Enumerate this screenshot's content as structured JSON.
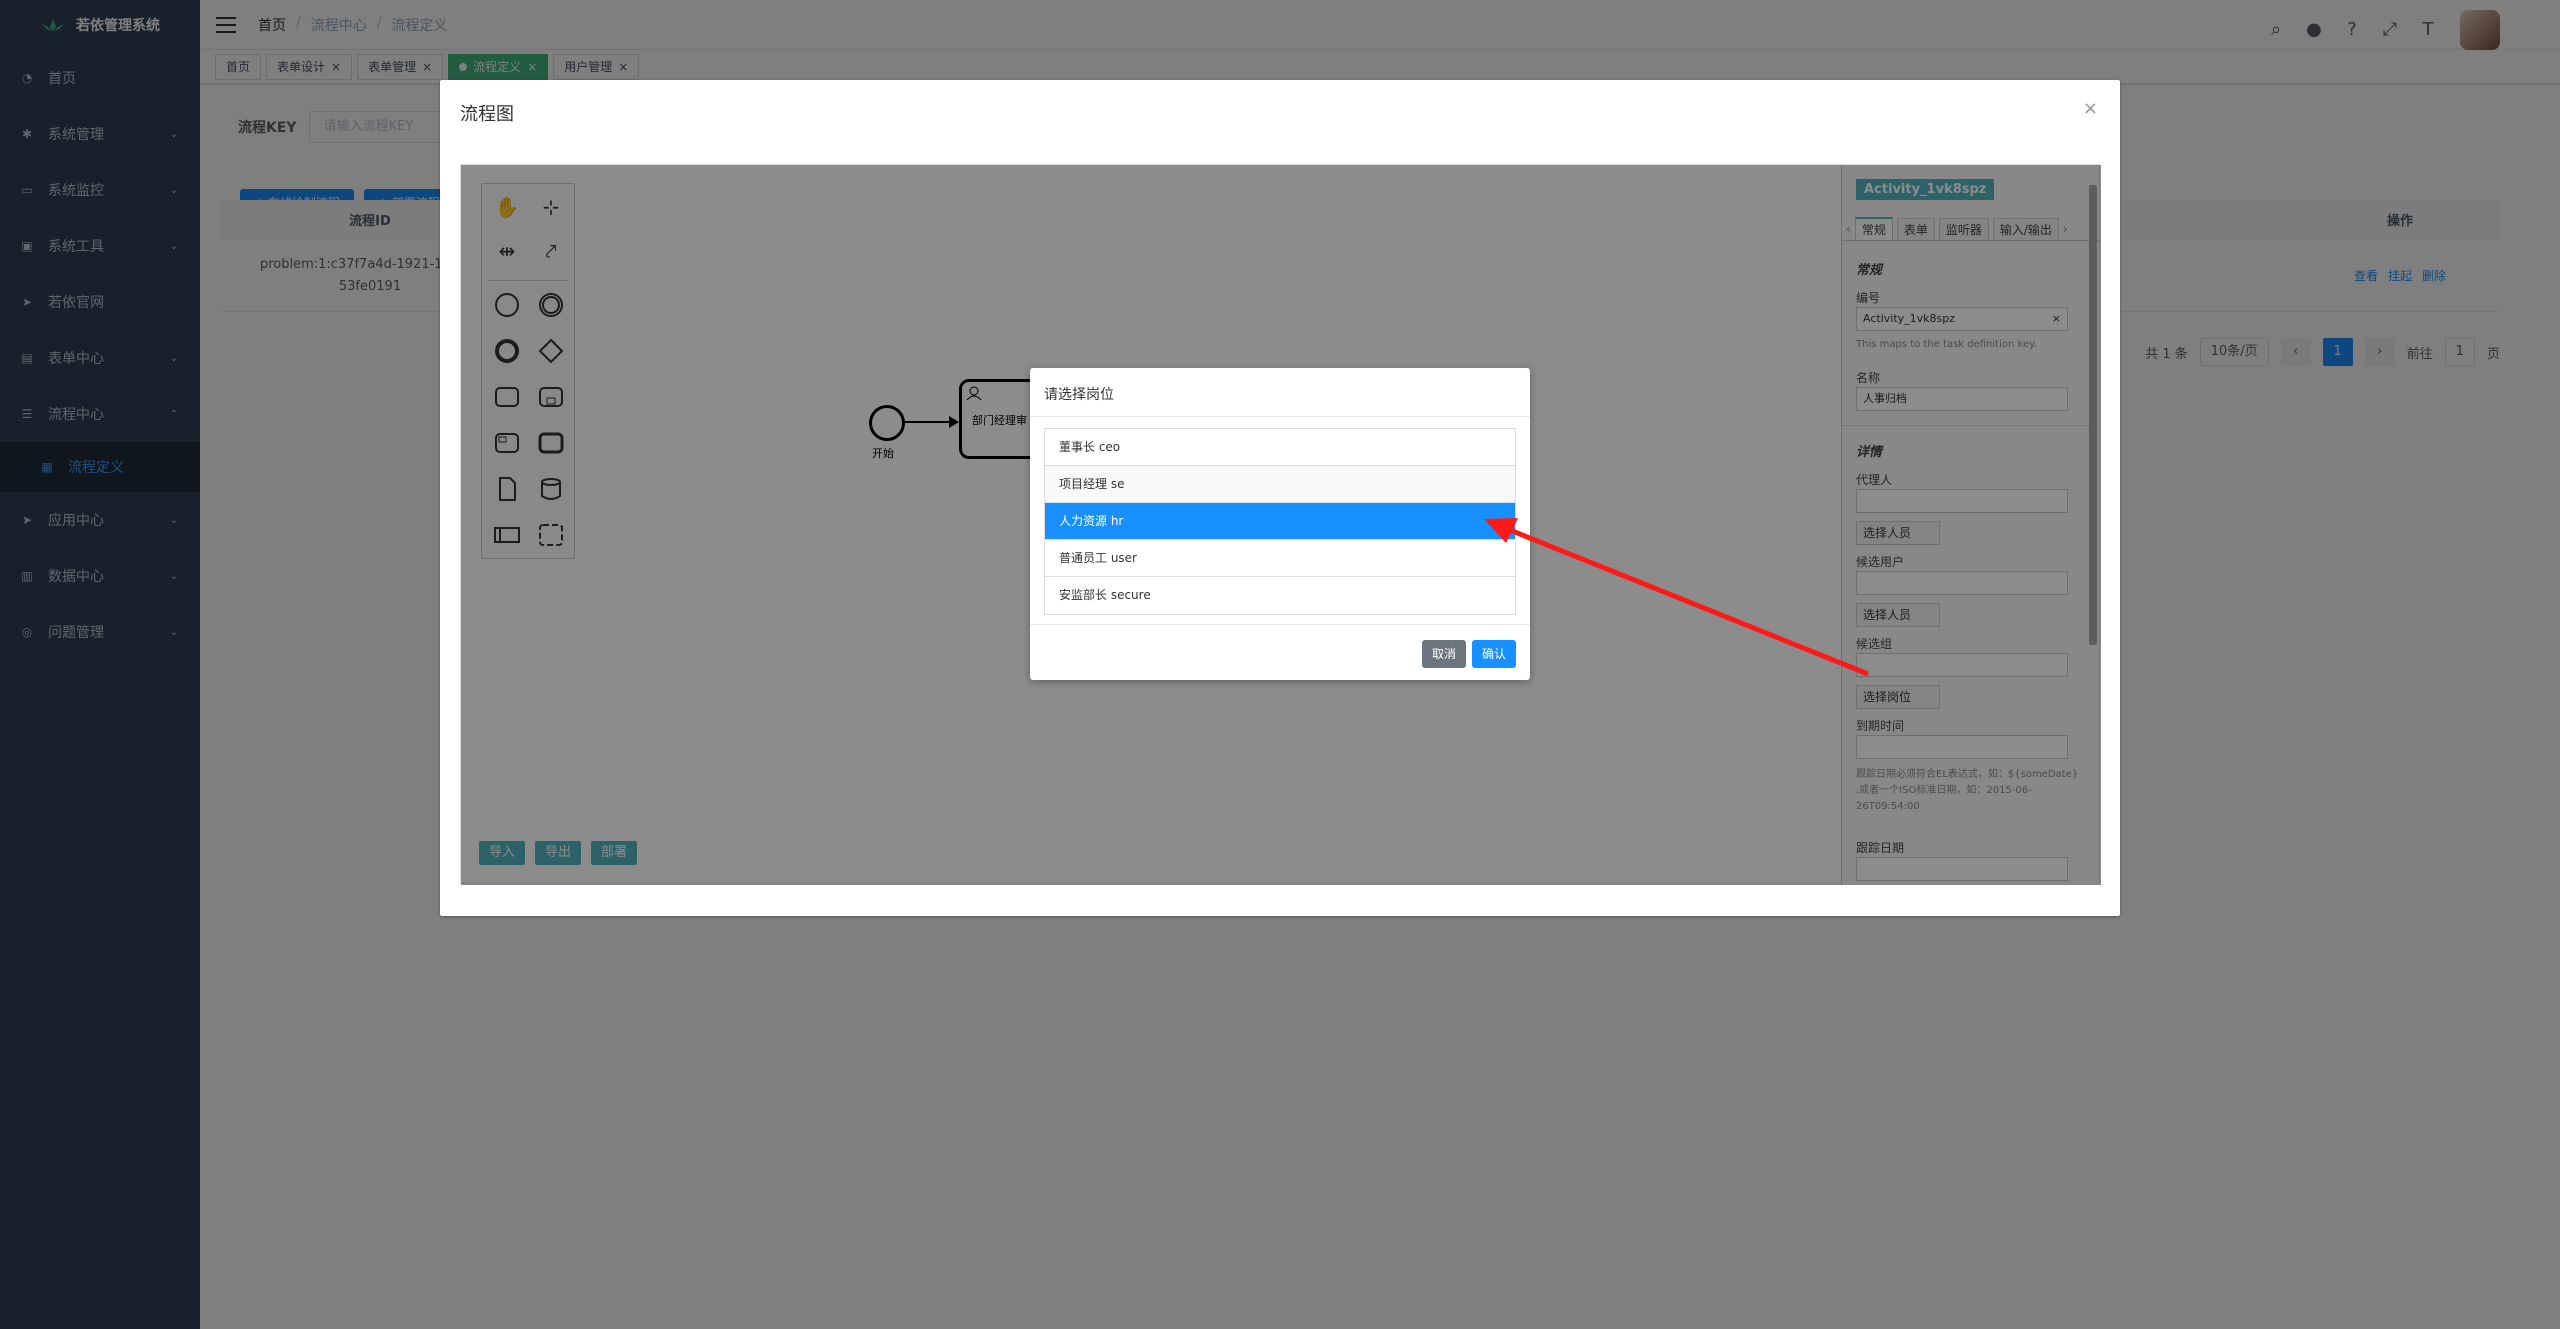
{
  "app": {
    "title": "若依管理系统"
  },
  "sidebar": {
    "items": [
      {
        "label": "首页",
        "icon": "dashboard-icon"
      },
      {
        "label": "系统管理",
        "icon": "gear-icon"
      },
      {
        "label": "系统监控",
        "icon": "monitor-icon"
      },
      {
        "label": "系统工具",
        "icon": "toolbox-icon"
      },
      {
        "label": "若依官网",
        "icon": "send-icon"
      },
      {
        "label": "表单中心",
        "icon": "form-icon"
      },
      {
        "label": "流程中心",
        "icon": "flow-icon"
      },
      {
        "label": "流程定义",
        "icon": "grid-icon"
      },
      {
        "label": "应用中心",
        "icon": "send-icon"
      },
      {
        "label": "数据中心",
        "icon": "chart-icon"
      },
      {
        "label": "问题管理",
        "icon": "bug-icon"
      }
    ]
  },
  "navbar": {
    "breadcrumb": [
      "首页",
      "流程中心",
      "流程定义"
    ],
    "icons": [
      "search-icon",
      "github-icon",
      "help-icon",
      "fullscreen-icon",
      "font-size-icon"
    ]
  },
  "tags": [
    "首页",
    "表单设计",
    "表单管理",
    "流程定义",
    "用户管理"
  ],
  "search": {
    "label": "流程KEY",
    "placeholder": "请输入流程KEY"
  },
  "toolbar": {
    "draw_label": "+ 在线绘制流程",
    "deploy_label": "+ 部署流程"
  },
  "table": {
    "headers": [
      "流程ID",
      "操作"
    ],
    "rows": [
      {
        "id_line1": "problem:1:c37f7a4d-1921-11ed-b",
        "id_line2": "53fe0191",
        "actions": [
          "查看",
          "挂起",
          "删除"
        ]
      }
    ]
  },
  "pager": {
    "total": "共 1 条",
    "page_size": "10条/页",
    "current": "1",
    "goto_label": "前往",
    "goto_value": "1",
    "page_suffix": "页"
  },
  "dialog": {
    "title": "流程图"
  },
  "diagram": {
    "start_label": "开始",
    "task_label": "部门经理审"
  },
  "props": {
    "header": "Activity_1vk8spz",
    "tabs": [
      "常规",
      "表单",
      "监听器",
      "输入/输出"
    ],
    "section_general": "常规",
    "id_label": "编号",
    "id_value": "Activity_1vk8spz",
    "id_hint": "This maps to the task definition key.",
    "name_label": "名称",
    "name_value": "人事归档",
    "section_details": "详情",
    "assignee_label": "代理人",
    "select_person": "选择人员",
    "candidate_users_label": "候选用户",
    "select_person2": "选择人员",
    "candidate_groups_label": "候选组",
    "select_post": "选择岗位",
    "due_label": "到期时间",
    "due_hint": "跟踪日期必须符合EL表达式，如：${someDate} ,或者一个ISO标准日期，如：2015-06-26T09:54:00",
    "follow_label": "跟踪日期"
  },
  "bottom_buttons": [
    "导入",
    "导出",
    "部署"
  ],
  "post_modal": {
    "title": "请选择岗位",
    "options": [
      "董事长 ceo",
      "项目经理 se",
      "人力资源 hr",
      "普通员工 user",
      "安监部长 secure"
    ],
    "selected": "人力资源 hr",
    "cancel": "取消",
    "confirm": "确认"
  },
  "colors": {
    "sidebar_bg": "#304156",
    "primary": "#1890ff",
    "bpmn_accent": "#52b4bd",
    "annotation_arrow": "#ff1a1a"
  }
}
